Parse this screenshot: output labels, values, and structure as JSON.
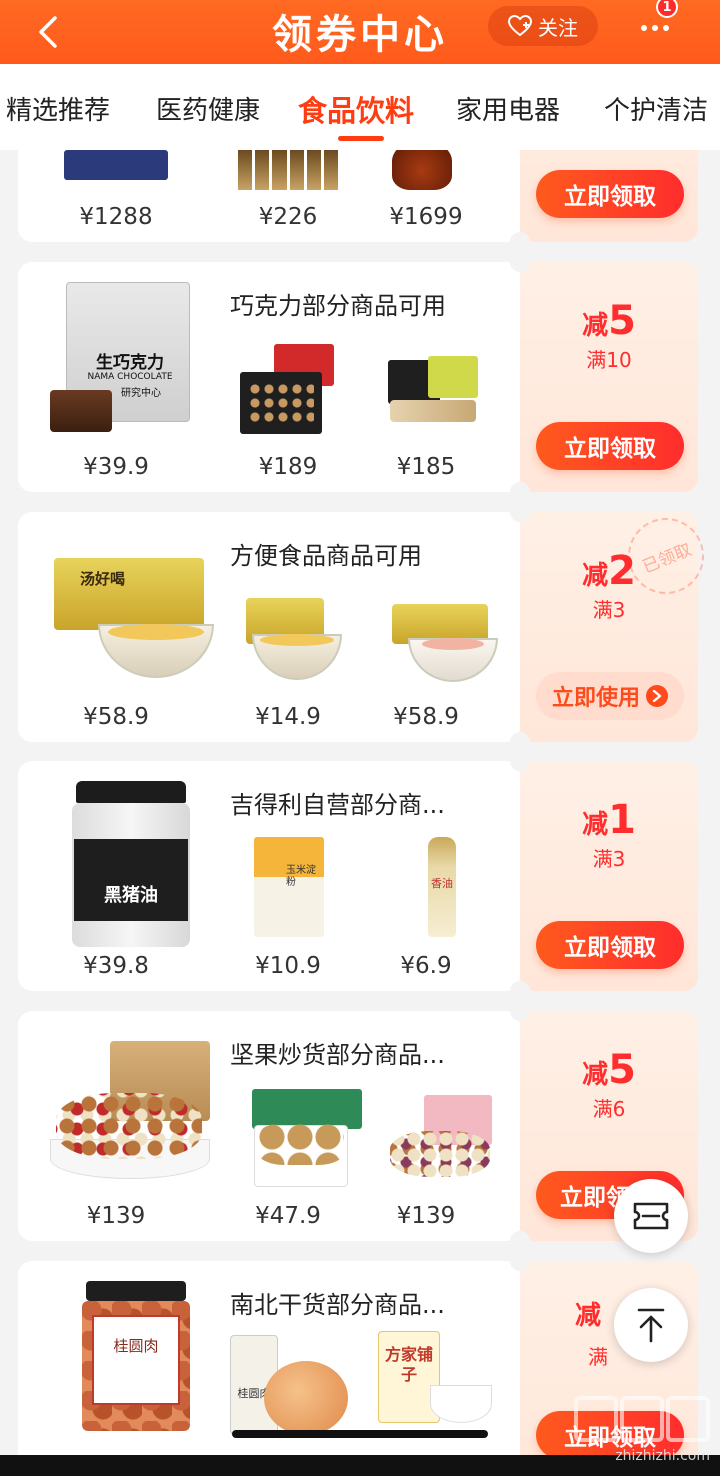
{
  "header": {
    "title": "领券中心",
    "follow_label": "关注",
    "notification_count": "1",
    "accent_color": "#ff5a1c"
  },
  "tabs": [
    {
      "label": "精选推荐",
      "active": false
    },
    {
      "label": "医药健康",
      "active": false
    },
    {
      "label": "食品饮料",
      "active": true
    },
    {
      "label": "家用电器",
      "active": false
    },
    {
      "label": "个护清洁",
      "active": false
    }
  ],
  "coupons": [
    {
      "title": "",
      "prices": [
        "¥1288",
        "¥226",
        "¥1699"
      ],
      "discount_label": "",
      "discount_amount": "",
      "threshold": "",
      "button": "立即领取",
      "claimed": false
    },
    {
      "title": "巧克力部分商品可用",
      "prices": [
        "¥39.9",
        "¥189",
        "¥185"
      ],
      "discount_label": "减",
      "discount_amount": "5",
      "threshold": "满10",
      "button": "立即领取",
      "claimed": false
    },
    {
      "title": "方便食品商品可用",
      "prices": [
        "¥58.9",
        "¥14.9",
        "¥58.9"
      ],
      "discount_label": "减",
      "discount_amount": "2",
      "threshold": "满3",
      "button": "立即使用",
      "claimed": true,
      "stamp": "已领取"
    },
    {
      "title": "吉得利自营部分商...",
      "prices": [
        "¥39.8",
        "¥10.9",
        "¥6.9"
      ],
      "discount_label": "减",
      "discount_amount": "1",
      "threshold": "满3",
      "button": "立即领取",
      "claimed": false
    },
    {
      "title": "坚果炒货部分商品...",
      "prices": [
        "¥139",
        "¥47.9",
        "¥139"
      ],
      "discount_label": "减",
      "discount_amount": "5",
      "threshold": "满6",
      "button": "立即领",
      "claimed": false
    },
    {
      "title": "南北干货部分商品...",
      "prices": [
        "",
        "",
        ""
      ],
      "discount_label": "减",
      "discount_amount": "",
      "threshold": "满",
      "button": "立即领取",
      "claimed": false
    }
  ],
  "product_labels": {
    "chocolate_pack_line1": "生巧克力",
    "chocolate_pack_line2": "NAMA CHOCOLATE",
    "chocolate_pack_line3": "研究中心",
    "noodle_box": "汤好喝",
    "lard_jar": "黑猪油",
    "starch_bag": "玉米淀粉",
    "sesame_bottle": "香油",
    "longan_jar": "桂圆肉",
    "longan_bag": "桂圆肉",
    "brand_box": "方家铺子"
  },
  "floating": {
    "coupon_icon": "ticket-icon",
    "top_icon": "arrow-up-icon"
  },
  "watermark": {
    "url": "zhizhizhi.com"
  }
}
